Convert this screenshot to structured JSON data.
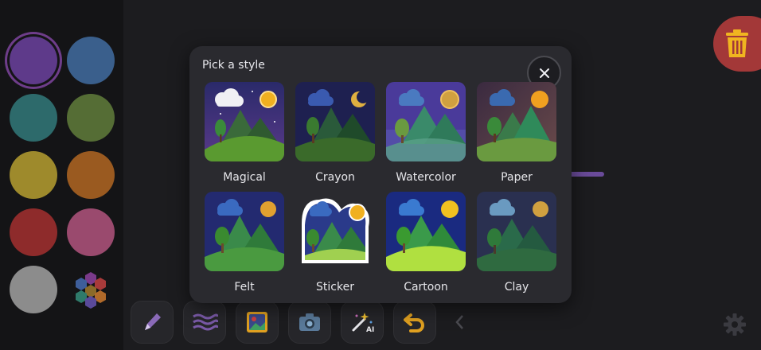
{
  "palette": {
    "colors": [
      {
        "name": "purple",
        "hex": "#5e3a8a",
        "selected": true
      },
      {
        "name": "blue",
        "hex": "#3a5f8c"
      },
      {
        "name": "teal",
        "hex": "#2d6a6b"
      },
      {
        "name": "olive",
        "hex": "#556d35"
      },
      {
        "name": "mustard",
        "hex": "#9e8a2c"
      },
      {
        "name": "orange",
        "hex": "#9a5a20"
      },
      {
        "name": "red",
        "hex": "#8e2b2b"
      },
      {
        "name": "pink",
        "hex": "#9a4a6e"
      },
      {
        "name": "gray",
        "hex": "#8c8c8c"
      }
    ],
    "multicolor_icon": "multicolor-hex-icon"
  },
  "modal": {
    "title": "Pick a style",
    "close_icon": "close-icon",
    "styles": [
      {
        "label": "Magical"
      },
      {
        "label": "Crayon"
      },
      {
        "label": "Watercolor"
      },
      {
        "label": "Paper"
      },
      {
        "label": "Felt"
      },
      {
        "label": "Sticker"
      },
      {
        "label": "Cartoon"
      },
      {
        "label": "Clay"
      }
    ]
  },
  "toolbar": {
    "tools": [
      "pen-icon",
      "waves-icon",
      "image-sticker-icon",
      "camera-icon",
      "magic-wand-ai-icon",
      "undo-icon"
    ],
    "ai_badge": "AI"
  },
  "colors": {
    "accent": "#6a4b9a",
    "trash": "#a33838",
    "trash_icon": "#f0b520"
  }
}
